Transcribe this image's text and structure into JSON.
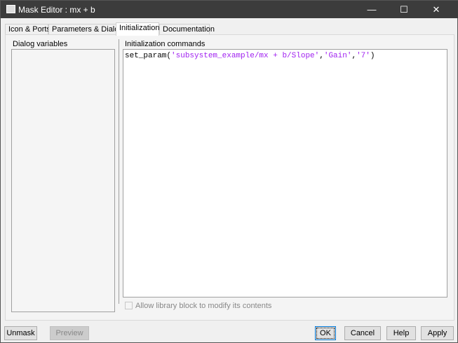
{
  "window": {
    "title": "Mask Editor : mx + b",
    "minimize": "—",
    "maximize": "☐",
    "close": "✕"
  },
  "tabs": [
    {
      "label": "Icon & Ports"
    },
    {
      "label": "Parameters & Dialog"
    },
    {
      "label": "Initialization"
    },
    {
      "label": "Documentation"
    }
  ],
  "dialog_variables": {
    "label": "Dialog variables"
  },
  "init": {
    "label": "Initialization commands",
    "code_prefix": "set_param(",
    "s1": "'subsystem_example/mx + b/Slope'",
    "c1": ",",
    "s2": "'Gain'",
    "c2": ",",
    "s3": "'7'",
    "suffix": ")"
  },
  "allow_library": {
    "label": "Allow library block to modify its contents",
    "checked": false
  },
  "buttons": {
    "unmask": "Unmask",
    "preview": "Preview",
    "ok": "OK",
    "cancel": "Cancel",
    "help": "Help",
    "apply": "Apply"
  }
}
